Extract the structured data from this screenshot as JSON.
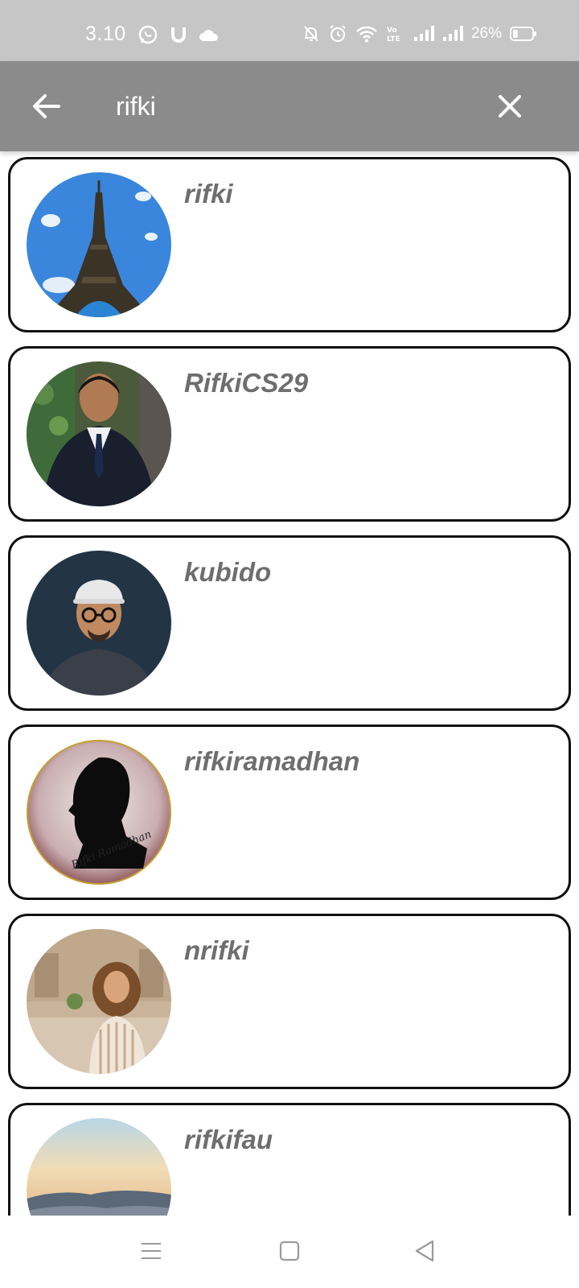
{
  "status_bar": {
    "time": "3.10",
    "battery_percent": "26%",
    "battery_level": 0.26,
    "left_icons": [
      "whatsapp-icon",
      "u-app-icon",
      "cloud-icon"
    ],
    "right_icons": [
      "bell-off-icon",
      "alarm-icon",
      "wifi-icon",
      "volte-icon",
      "signal-icon",
      "signal-icon",
      "battery-icon"
    ]
  },
  "app_bar": {
    "back_icon": "arrow-left-icon",
    "search_value": "rifki",
    "clear_icon": "close-icon"
  },
  "results": [
    {
      "username": "rifki",
      "avatar": "eiffel-tower-photo"
    },
    {
      "username": "RifkiCS29",
      "avatar": "man-in-suit-photo"
    },
    {
      "username": "kubido",
      "avatar": "man-with-cap-photo"
    },
    {
      "username": "rifkiramadhan",
      "avatar": "silhouette-logo",
      "avatar_text": "Rifki Ramadhan"
    },
    {
      "username": "nrifki",
      "avatar": "woman-photo"
    },
    {
      "username": "rifkifau",
      "avatar": "landscape-photo"
    }
  ],
  "nav_bar": {
    "icons": [
      "menu-icon",
      "home-square-icon",
      "back-triangle-icon"
    ]
  },
  "colors": {
    "status_bar_bg": "#c6c6c6",
    "app_bar_bg": "#8b8b8b",
    "username_text": "#6e6e6e",
    "card_border": "#111111"
  }
}
